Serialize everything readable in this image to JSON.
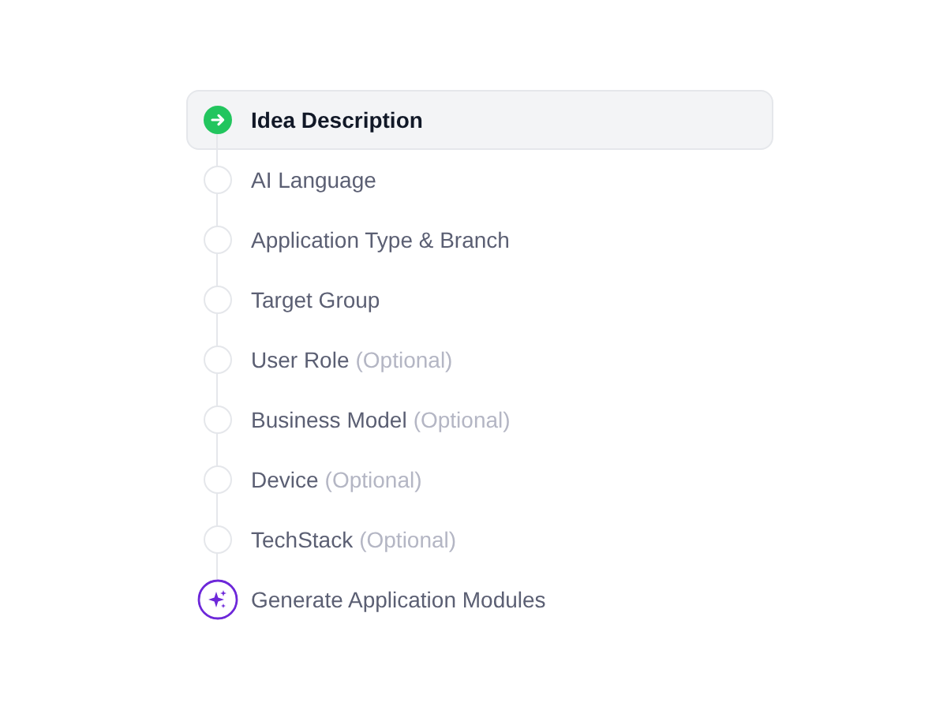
{
  "steps": [
    {
      "kind": "step",
      "label": "Idea Description",
      "selected": true
    },
    {
      "kind": "step",
      "label": "AI Language",
      "selected": false
    },
    {
      "kind": "step",
      "label": "Application Type & Branch",
      "selected": false
    },
    {
      "kind": "step",
      "label": "Target Group",
      "selected": false
    },
    {
      "kind": "step",
      "label": "User Role",
      "note": "(Optional)",
      "selected": false
    },
    {
      "kind": "step",
      "label": "Business Model",
      "note": "(Optional)",
      "selected": false
    },
    {
      "kind": "step",
      "label": "Device",
      "note": "(Optional)",
      "selected": false
    },
    {
      "kind": "step",
      "label": "TechStack",
      "note": "(Optional)",
      "selected": false
    },
    {
      "kind": "generate",
      "label": "Generate Application Modules",
      "selected": false
    }
  ]
}
